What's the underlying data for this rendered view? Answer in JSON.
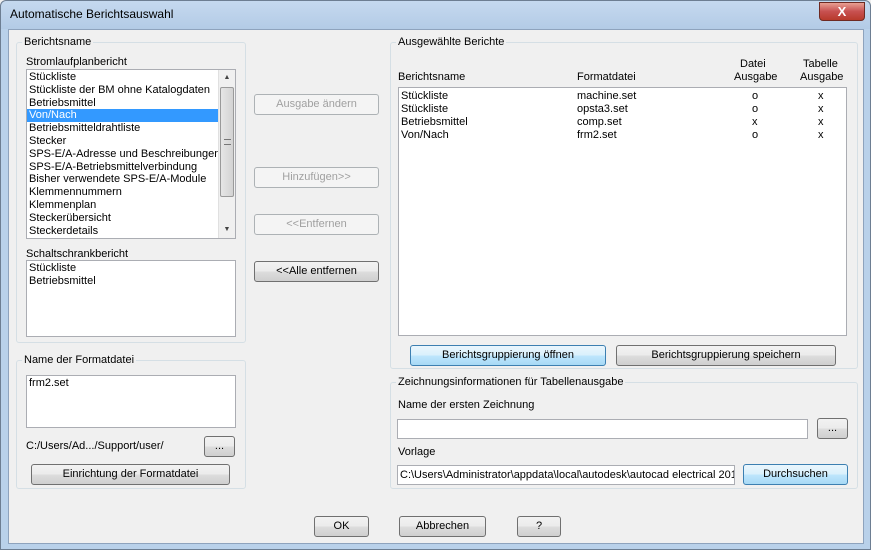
{
  "window": {
    "title": "Automatische Berichtsauswahl",
    "close_glyph": "X"
  },
  "left": {
    "berichtsname_group": "Berichtsname",
    "stromlauf_label": "Stromlaufplanbericht",
    "stromlauf_items": [
      "Stückliste",
      "Stückliste der BM ohne Katalogdaten",
      "Betriebsmittel",
      "Von/Nach",
      "Betriebsmitteldrahtliste",
      "Stecker",
      "SPS-E/A-Adresse und Beschreibungen",
      "SPS-E/A-Betriebsmittelverbindung",
      "Bisher verwendete SPS-E/A-Module",
      "Klemmennummern",
      "Klemmenplan",
      "Steckerübersicht",
      "Steckerdetails"
    ],
    "selected_index": 3,
    "schaltschrank_label": "Schaltschrankbericht",
    "schaltschrank_items": [
      "Stückliste",
      "Betriebsmittel"
    ],
    "format_group": "Name der Formatdatei",
    "format_items": [
      "frm2.set"
    ],
    "path_text": "C:/Users/Ad.../Support/user/",
    "browse_label": "...",
    "setup_label": "Einrichtung der Formatdatei"
  },
  "middle": {
    "ausgabe_label": "Ausgabe ändern",
    "hinzufuegen_label": "Hinzufügen>>",
    "entfernen_label": "<<Entfernen",
    "alle_entfernen_label": "<<Alle entfernen"
  },
  "right": {
    "selected_group": "Ausgewählte Berichte",
    "columns": {
      "name": "Berichtsname",
      "format": "Formatdatei",
      "datei_line1": "Datei",
      "datei_line2": "Ausgabe",
      "tabelle_line1": "Tabelle",
      "tabelle_line2": "Ausgabe"
    },
    "rows": [
      {
        "name": "Stückliste",
        "format": "machine.set",
        "datei": "o",
        "tabelle": "x"
      },
      {
        "name": "Stückliste",
        "format": "opsta3.set",
        "datei": "o",
        "tabelle": "x"
      },
      {
        "name": "Betriebsmittel",
        "format": "comp.set",
        "datei": "x",
        "tabelle": "x"
      },
      {
        "name": "Von/Nach",
        "format": "frm2.set",
        "datei": "o",
        "tabelle": "x"
      }
    ],
    "open_group_label": "Berichtsgruppierung öffnen",
    "save_group_label": "Berichtsgruppierung speichern",
    "drawing_group": "Zeichnungsinformationen für Tabellenausgabe",
    "first_drawing_label": "Name der ersten Zeichnung",
    "first_drawing_value": "",
    "first_drawing_browse": "...",
    "vorlage_label": "Vorlage",
    "vorlage_value": "C:\\Users\\Administrator\\appdata\\local\\autodesk\\autocad electrical 201",
    "durchsuchen_label": "Durchsuchen"
  },
  "footer": {
    "ok_label": "OK",
    "abbrechen_label": "Abbrechen",
    "help_label": "?"
  }
}
